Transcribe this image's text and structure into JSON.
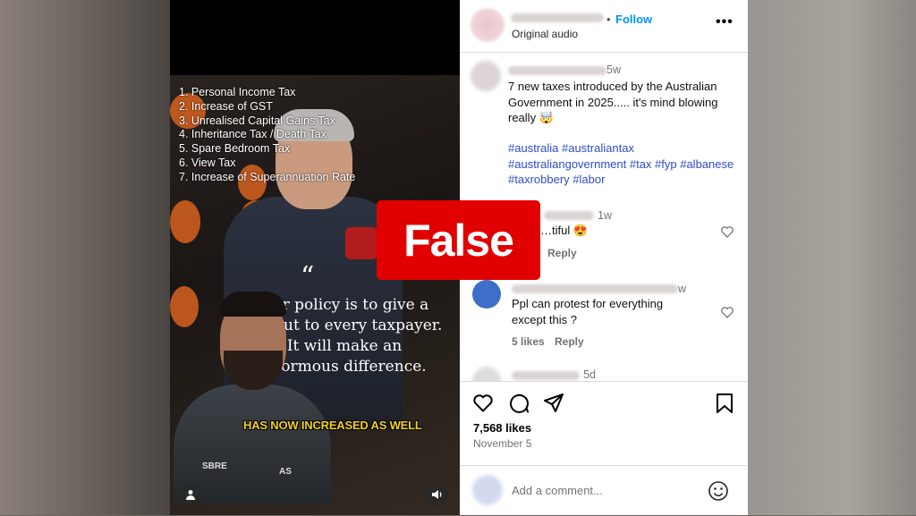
{
  "video": {
    "tax_list": [
      "1. Personal Income Tax",
      "2. Increase of GST",
      "3. Unrealised Capital Gains Tax",
      "4. Inheritance Tax / Death Tax",
      "5. Spare Bedroom Tax",
      "6. View Tax",
      "7. Increase of Superannuation Rate"
    ],
    "quote_mark": "“",
    "quote_lines": [
      "Our policy is to give a",
      "tax cut to every taxpayer.",
      "It will make an",
      "enormous difference."
    ],
    "caption": "HAS NOW INCREASED AS WELL",
    "shirt_badge_left": "SBRE",
    "shirt_badge_right": "AS"
  },
  "post": {
    "follow_label": "Follow",
    "separator": "•",
    "audio_label": "Original audio",
    "more_label": "•••",
    "caption_age": "5w",
    "caption_text": "7 new taxes introduced by the Australian Government in 2025..... it's mind blowing really 🤯",
    "hashtags": "#australia #australiantax #australiangovernment #tax #fyp #albanese #taxrobbery #labor",
    "comments": [
      {
        "age": "1w",
        "text": "…tiful 😍",
        "reply_label": "Reply"
      },
      {
        "age": "w",
        "text": "Ppl can protest for everything except this ?",
        "likes_label": "5 likes",
        "reply_label": "Reply"
      },
      {
        "age": "5d"
      }
    ],
    "likes": "7,568 likes",
    "date": "November 5",
    "add_comment_placeholder": "Add a comment..."
  },
  "overlay": {
    "verdict": "False",
    "color": "#e00000"
  }
}
